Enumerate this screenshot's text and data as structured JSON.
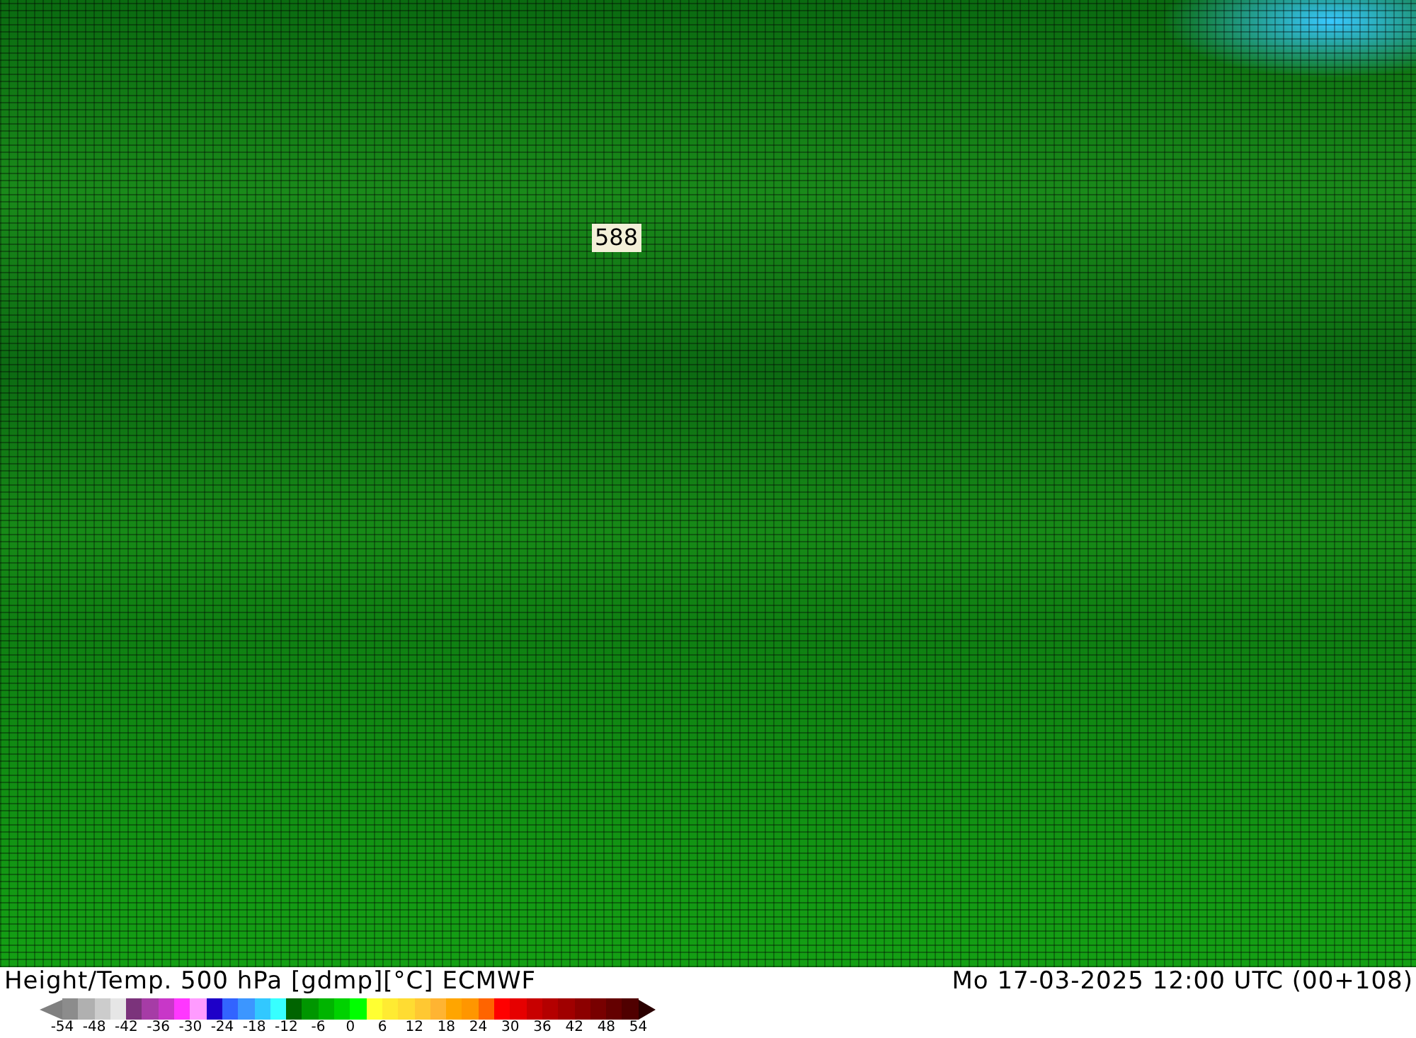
{
  "map": {
    "labels": [
      {
        "text": "588"
      }
    ]
  },
  "footer": {
    "title": "Height/Temp. 500 hPa [gdmp][°C] ECMWF",
    "valid_time": "Mo 17-03-2025 12:00 UTC (00+108)"
  },
  "legend": {
    "swatches": [
      {
        "kind": "arrow",
        "color": "#808080"
      },
      {
        "kind": "box",
        "color": "#8c8c8c"
      },
      {
        "kind": "box",
        "color": "#b0b0b0"
      },
      {
        "kind": "box",
        "color": "#cccccc"
      },
      {
        "kind": "box",
        "color": "#e6e6e6"
      },
      {
        "kind": "box",
        "color": "#7b337b"
      },
      {
        "kind": "box",
        "color": "#a63ca6"
      },
      {
        "kind": "box",
        "color": "#c837c8"
      },
      {
        "kind": "box",
        "color": "#ff37ff"
      },
      {
        "kind": "box",
        "color": "#ff9bff"
      },
      {
        "kind": "box",
        "color": "#1e00c8"
      },
      {
        "kind": "box",
        "color": "#3264ff"
      },
      {
        "kind": "box",
        "color": "#3c96ff"
      },
      {
        "kind": "box",
        "color": "#32c8ff"
      },
      {
        "kind": "box",
        "color": "#37ffff"
      },
      {
        "kind": "box",
        "color": "#006400"
      },
      {
        "kind": "box",
        "color": "#009600"
      },
      {
        "kind": "box",
        "color": "#00b400"
      },
      {
        "kind": "box",
        "color": "#00d200"
      },
      {
        "kind": "box",
        "color": "#00ff00"
      },
      {
        "kind": "box",
        "color": "#ffff32"
      },
      {
        "kind": "box",
        "color": "#ffeb32"
      },
      {
        "kind": "box",
        "color": "#ffdc32"
      },
      {
        "kind": "box",
        "color": "#ffc832"
      },
      {
        "kind": "box",
        "color": "#ffb432"
      },
      {
        "kind": "box",
        "color": "#ffa500"
      },
      {
        "kind": "box",
        "color": "#ff9600"
      },
      {
        "kind": "box",
        "color": "#ff6400"
      },
      {
        "kind": "box",
        "color": "#ff0000"
      },
      {
        "kind": "box",
        "color": "#e60000"
      },
      {
        "kind": "box",
        "color": "#c80000"
      },
      {
        "kind": "box",
        "color": "#b40000"
      },
      {
        "kind": "box",
        "color": "#a00000"
      },
      {
        "kind": "box",
        "color": "#8c0000"
      },
      {
        "kind": "box",
        "color": "#780000"
      },
      {
        "kind": "box",
        "color": "#640000"
      },
      {
        "kind": "box",
        "color": "#500000"
      },
      {
        "kind": "arrow",
        "color": "#2a0000"
      }
    ],
    "ticks": [
      "-54",
      "-48",
      "-42",
      "-36",
      "-30",
      "-24",
      "-18",
      "-12",
      "-6",
      "0",
      "6",
      "12",
      "18",
      "24",
      "30",
      "36",
      "42",
      "48",
      "54"
    ]
  }
}
